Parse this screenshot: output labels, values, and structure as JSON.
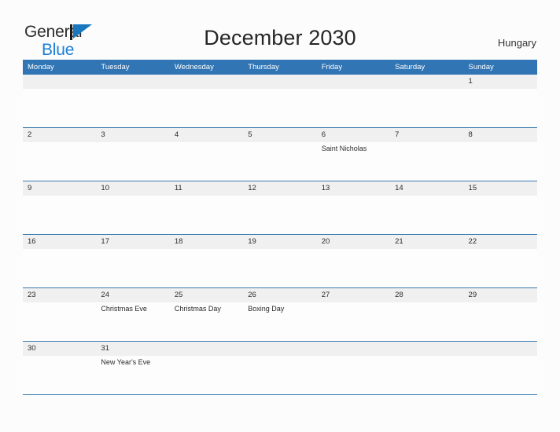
{
  "brand": {
    "word_general": "General",
    "word_blue": "Blue",
    "mark_name": "general-blue-logo"
  },
  "header": {
    "title": "December 2030",
    "country": "Hungary"
  },
  "colors": {
    "header_blue": "#3175B5",
    "rule_blue": "#3C7CB0",
    "date_band_gray": "#F0F0F0",
    "logo_blue": "#1B7FD4",
    "page_background": "#FCFCFC",
    "text_dark": "#2B2B2B"
  },
  "calendar": {
    "month": "December",
    "year": "2030",
    "weekday_headers": [
      "Monday",
      "Tuesday",
      "Wednesday",
      "Thursday",
      "Friday",
      "Saturday",
      "Sunday"
    ],
    "weeks": [
      {
        "days": [
          {
            "date": "",
            "events": []
          },
          {
            "date": "",
            "events": []
          },
          {
            "date": "",
            "events": []
          },
          {
            "date": "",
            "events": []
          },
          {
            "date": "",
            "events": []
          },
          {
            "date": "",
            "events": []
          },
          {
            "date": "1",
            "events": []
          }
        ]
      },
      {
        "days": [
          {
            "date": "2",
            "events": []
          },
          {
            "date": "3",
            "events": []
          },
          {
            "date": "4",
            "events": []
          },
          {
            "date": "5",
            "events": []
          },
          {
            "date": "6",
            "events": [
              "Saint Nicholas"
            ]
          },
          {
            "date": "7",
            "events": []
          },
          {
            "date": "8",
            "events": []
          }
        ]
      },
      {
        "days": [
          {
            "date": "9",
            "events": []
          },
          {
            "date": "10",
            "events": []
          },
          {
            "date": "11",
            "events": []
          },
          {
            "date": "12",
            "events": []
          },
          {
            "date": "13",
            "events": []
          },
          {
            "date": "14",
            "events": []
          },
          {
            "date": "15",
            "events": []
          }
        ]
      },
      {
        "days": [
          {
            "date": "16",
            "events": []
          },
          {
            "date": "17",
            "events": []
          },
          {
            "date": "18",
            "events": []
          },
          {
            "date": "19",
            "events": []
          },
          {
            "date": "20",
            "events": []
          },
          {
            "date": "21",
            "events": []
          },
          {
            "date": "22",
            "events": []
          }
        ]
      },
      {
        "days": [
          {
            "date": "23",
            "events": []
          },
          {
            "date": "24",
            "events": [
              "Christmas Eve"
            ]
          },
          {
            "date": "25",
            "events": [
              "Christmas Day"
            ]
          },
          {
            "date": "26",
            "events": [
              "Boxing Day"
            ]
          },
          {
            "date": "27",
            "events": []
          },
          {
            "date": "28",
            "events": []
          },
          {
            "date": "29",
            "events": []
          }
        ]
      },
      {
        "days": [
          {
            "date": "30",
            "events": []
          },
          {
            "date": "31",
            "events": [
              "New Year's Eve"
            ]
          },
          {
            "date": "",
            "events": []
          },
          {
            "date": "",
            "events": []
          },
          {
            "date": "",
            "events": []
          },
          {
            "date": "",
            "events": []
          },
          {
            "date": "",
            "events": []
          }
        ]
      }
    ]
  }
}
